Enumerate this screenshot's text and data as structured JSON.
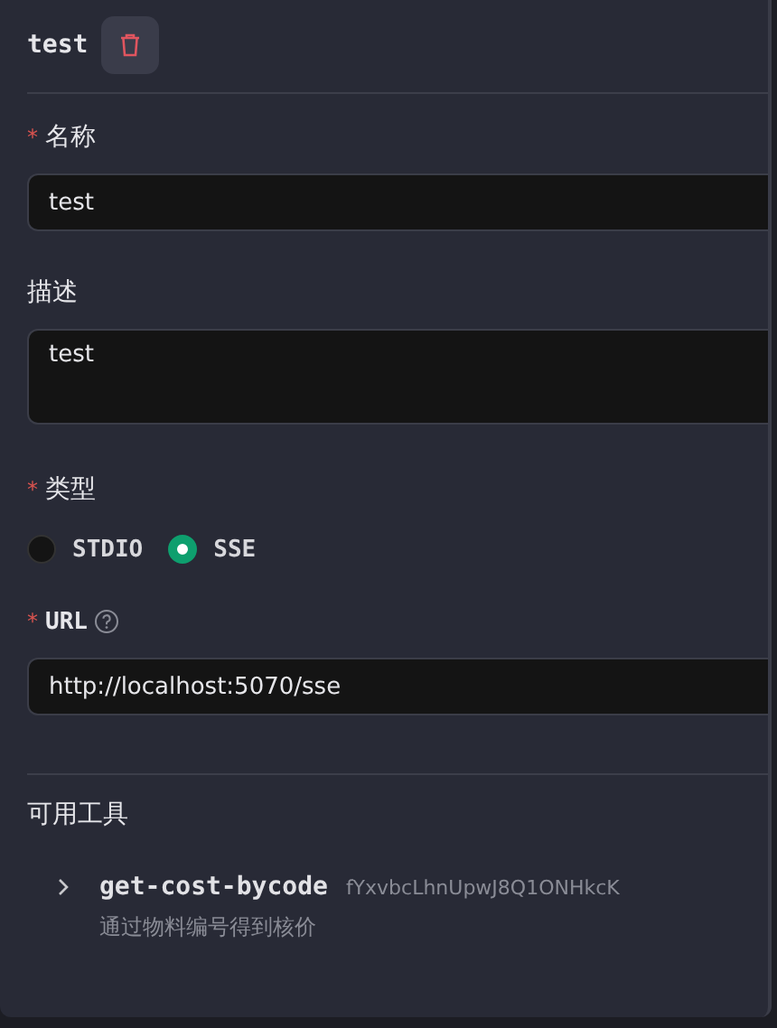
{
  "header": {
    "title": "test"
  },
  "fields": [
    {
      "kind": "input",
      "label": "名称",
      "required_mark": "*",
      "value": "test"
    },
    {
      "kind": "textarea",
      "label": "描述",
      "value": "test"
    },
    {
      "kind": "radio",
      "label": "类型",
      "required_mark": "*",
      "options": [
        {
          "label": "STDIO",
          "selected": false
        },
        {
          "label": "SSE",
          "selected": true
        }
      ]
    },
    {
      "kind": "input",
      "label": "URL",
      "required_mark": "*",
      "help": true,
      "value": "http://localhost:5070/sse"
    }
  ],
  "tools": {
    "title": "可用工具",
    "items": [
      {
        "name": "get-cost-bycode",
        "id": "fYxvbcLhnUpwJ8Q1ONHkcK",
        "description": "通过物料编号得到核价",
        "expanded": false
      }
    ]
  }
}
